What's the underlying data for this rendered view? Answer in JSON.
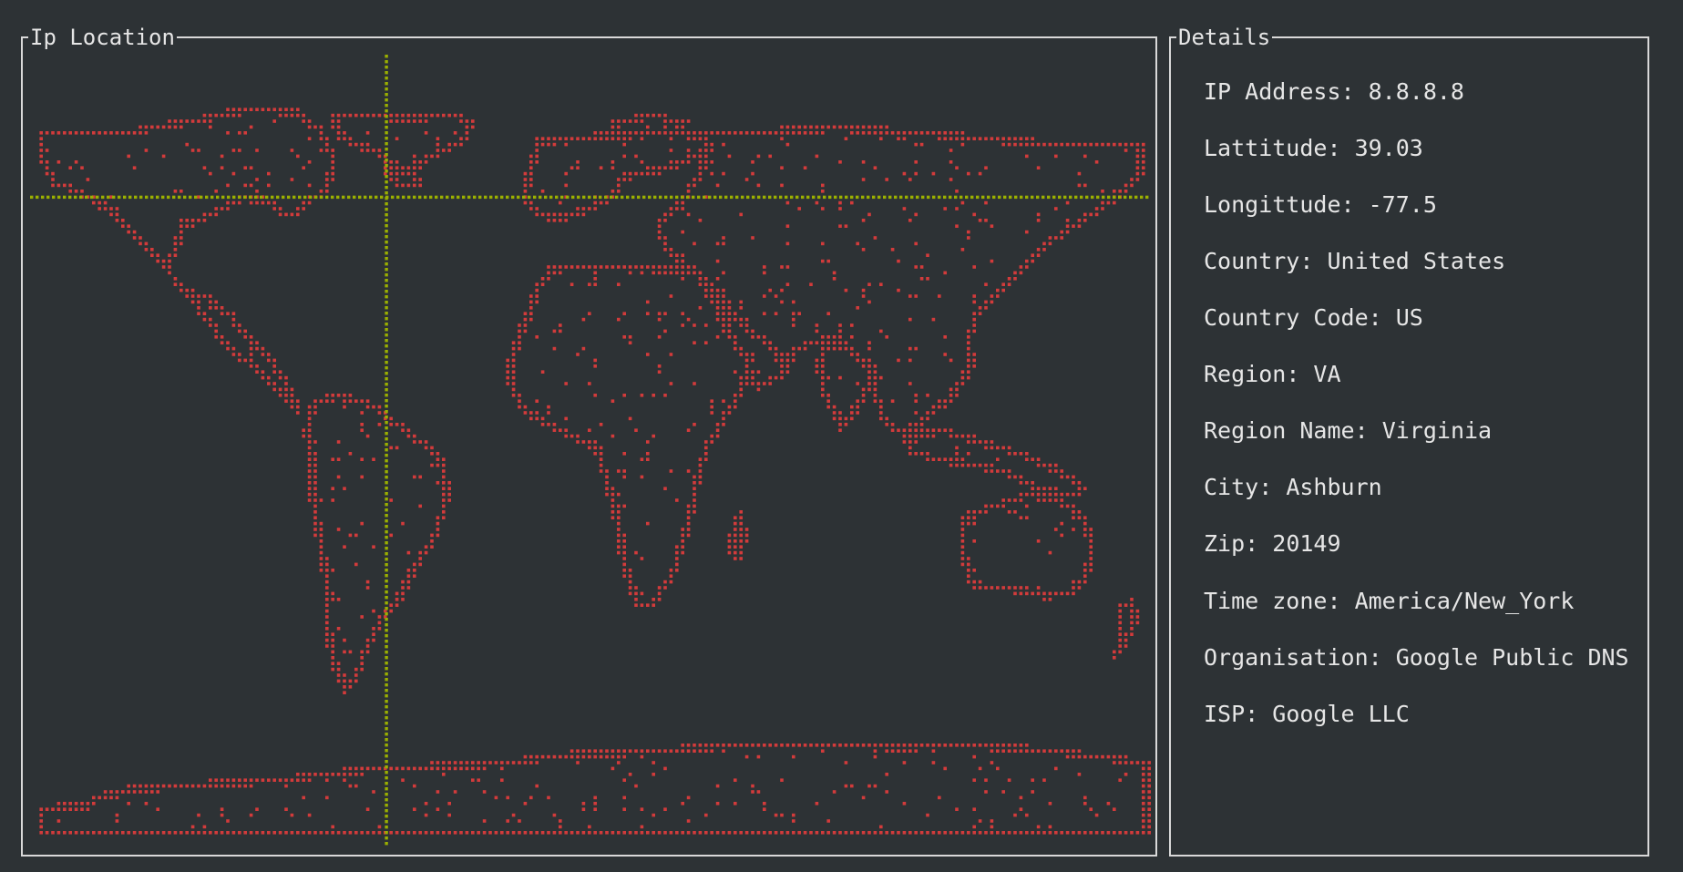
{
  "map_panel": {
    "title": "Ip Location"
  },
  "details_panel": {
    "title": "Details",
    "rows": [
      {
        "label": "IP Address",
        "value": "8.8.8.8"
      },
      {
        "label": "Lattitude",
        "value": "39.03"
      },
      {
        "label": "Longittude",
        "value": "-77.5"
      },
      {
        "label": "Country",
        "value": "United States"
      },
      {
        "label": "Country Code",
        "value": "US"
      },
      {
        "label": "Region",
        "value": "VA"
      },
      {
        "label": "Region Name",
        "value": "Virginia"
      },
      {
        "label": "City",
        "value": "Ashburn"
      },
      {
        "label": "Zip",
        "value": "20149"
      },
      {
        "label": "Time zone",
        "value": "America/New_York"
      },
      {
        "label": "Organisation",
        "value": "Google Public DNS"
      },
      {
        "label": "ISP",
        "value": "Google LLC"
      }
    ]
  },
  "marker": {
    "lat": 39.03,
    "lon": -77.5
  },
  "colors": {
    "background": "#2d3235",
    "border": "#d9d9d9",
    "text": "#e6e6e6",
    "land": "#d23b3b",
    "crosshair": "#9bb000"
  }
}
